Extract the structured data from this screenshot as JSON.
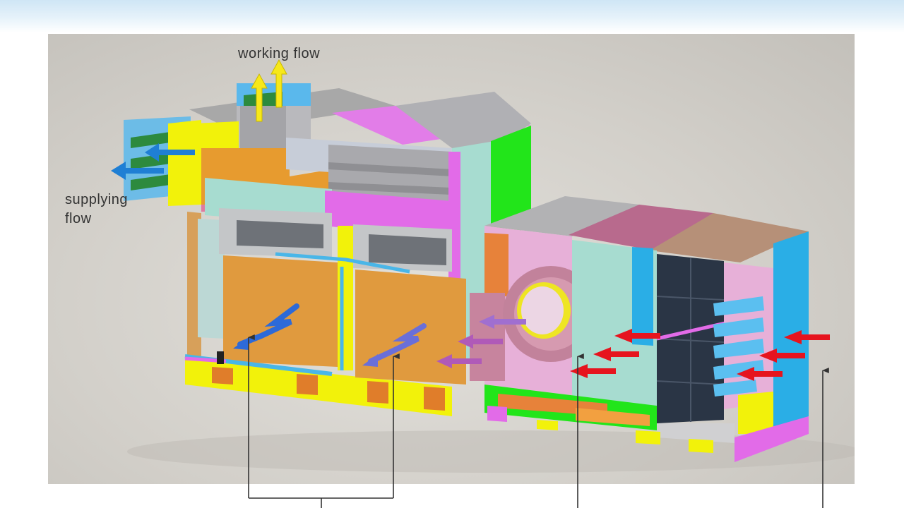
{
  "labels": {
    "working_flow": "working flow",
    "supplying_flow_line1": "supplying",
    "supplying_flow_line2": "flow"
  },
  "colors": {
    "panel_bg": "#d3d0ca",
    "orange": "#e79b2f",
    "magenta": "#e26be8",
    "yellow": "#f2f20a",
    "green": "#22e51a",
    "cyan": "#2aaee6",
    "mint": "#a7dcd0",
    "mauve": "#b86a8d",
    "tan": "#b69078",
    "navy": "#2a3545",
    "arrow_supply": "#1f7fd4",
    "arrow_work": "#f7e81a",
    "arrow_intake": "#e6141e",
    "arrow_internal": "#9b6fd6"
  },
  "icons": [
    "blue-arrow-icon",
    "yellow-arrow-icon",
    "red-arrow-icon",
    "purple-arrow-icon",
    "fan-icon"
  ]
}
